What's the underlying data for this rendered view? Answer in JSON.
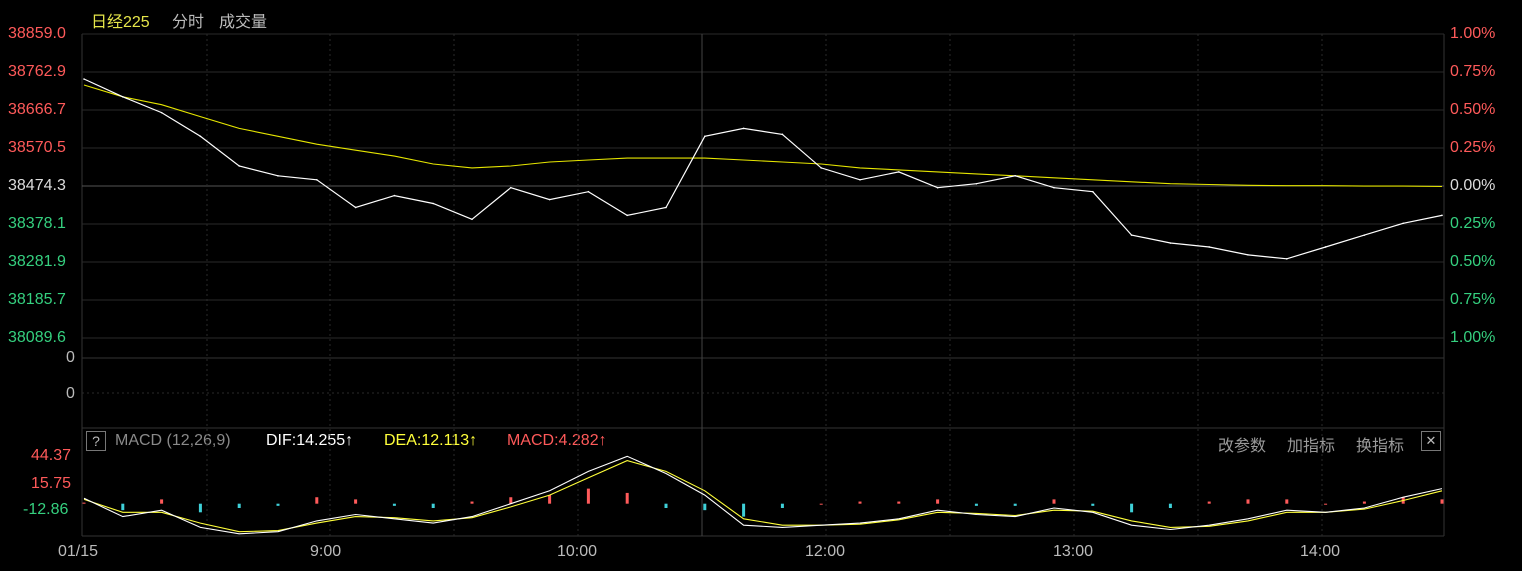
{
  "header": {
    "index_name": "日经225",
    "tab_minute": "分时",
    "tab_volume": "成交量"
  },
  "colors": {
    "up": "#ff5a5a",
    "down": "#35d07f",
    "price_line": "#ffffff",
    "avg_line": "#e6e600",
    "macd_up": "#ff5a5a",
    "macd_down": "#3fd0d8",
    "grid": "#2a2a2a",
    "border": "#333333",
    "dif_color": "#ffffff",
    "dea_color": "#ffff3a",
    "macd_color": "#ff5a5a"
  },
  "price_axis": {
    "left": [
      "38859.0",
      "38762.9",
      "38666.7",
      "38570.5",
      "38474.3",
      "38378.1",
      "38281.9",
      "38185.7",
      "38089.6"
    ],
    "right": [
      "1.00%",
      "0.75%",
      "0.50%",
      "0.25%",
      "0.00%",
      "0.25%",
      "0.50%",
      "0.75%",
      "1.00%"
    ]
  },
  "volume_axis": {
    "top": "0",
    "mid": "0"
  },
  "macd_panel": {
    "help": "?",
    "name": "MACD (12,26,9)",
    "dif": "DIF:14.255↑",
    "dea": "DEA:12.113↑",
    "macd": "MACD:4.282↑",
    "axis": [
      "44.37",
      "15.75",
      "-12.86"
    ],
    "buttons": [
      "改参数",
      "加指标",
      "换指标"
    ],
    "close": "✕"
  },
  "time_axis": [
    "01/15",
    "9:00",
    "10:00",
    "12:00",
    "13:00",
    "14:00"
  ],
  "chart_data": [
    {
      "type": "line",
      "title": "日经225",
      "ylim": [
        38089.6,
        38859.0
      ],
      "prev_close": 38474.3,
      "x": [
        "08:45",
        "08:50",
        "08:55",
        "09:00",
        "09:10",
        "09:20",
        "09:30",
        "09:40",
        "09:50",
        "10:00",
        "10:05",
        "10:10",
        "10:20",
        "10:30",
        "10:40",
        "10:50",
        "11:00",
        "11:10",
        "11:20",
        "11:30",
        "12:00",
        "12:10",
        "12:20",
        "12:30",
        "12:40",
        "12:50",
        "13:00",
        "13:10",
        "13:20",
        "13:30",
        "13:40",
        "13:50",
        "14:00",
        "14:10",
        "14:20",
        "14:30"
      ],
      "series": [
        {
          "values": [
            38745,
            38700,
            38660,
            38600,
            38525,
            38500,
            38490,
            38420,
            38450,
            38430,
            38390,
            38470,
            38440,
            38460,
            38400,
            38420,
            38600,
            38620,
            38605,
            38520,
            38490,
            38510,
            38470,
            38480,
            38500,
            38470,
            38460,
            38350,
            38330,
            38320,
            38300,
            38290,
            38320,
            38350,
            38380,
            38400
          ]
        },
        {
          "values": [
            38730,
            38700,
            38680,
            38650,
            38620,
            38600,
            38580,
            38565,
            38550,
            38530,
            38520,
            38525,
            38535,
            38540,
            38545,
            38545,
            38545,
            38540,
            38535,
            38530,
            38520,
            38515,
            38510,
            38505,
            38500,
            38495,
            38490,
            38485,
            38480,
            38478,
            38476,
            38475,
            38475,
            38474,
            38474,
            38473
          ]
        }
      ]
    },
    {
      "type": "bar",
      "title": "MACD (12,26,9)",
      "ylim": [
        -30,
        48
      ],
      "series": [
        {
          "name": "DIF",
          "values": [
            5,
            -12,
            -6,
            -22,
            -28,
            -26,
            -16,
            -10,
            -14,
            -18,
            -12,
            0,
            12,
            30,
            44,
            28,
            8,
            -20,
            -22,
            -20,
            -18,
            -14,
            -6,
            -10,
            -12,
            -4,
            -8,
            -20,
            -24,
            -20,
            -14,
            -6,
            -8,
            -4,
            6,
            14
          ]
        },
        {
          "name": "DEA",
          "values": [
            4,
            -8,
            -8,
            -18,
            -26,
            -25,
            -18,
            -12,
            -13,
            -16,
            -13,
            -3,
            8,
            24,
            40,
            30,
            12,
            -14,
            -20,
            -20,
            -19,
            -15,
            -8,
            -9,
            -11,
            -6,
            -7,
            -16,
            -22,
            -21,
            -16,
            -8,
            -8,
            -5,
            3,
            12
          ]
        },
        {
          "name": "MACD",
          "values": [
            1,
            -6,
            4,
            -8,
            -4,
            -2,
            6,
            4,
            -2,
            -4,
            2,
            6,
            8,
            14,
            10,
            -4,
            -6,
            -12,
            -4,
            0,
            2,
            2,
            4,
            -2,
            -2,
            4,
            -2,
            -8,
            -4,
            2,
            4,
            4,
            0,
            2,
            6,
            4
          ]
        }
      ]
    }
  ]
}
